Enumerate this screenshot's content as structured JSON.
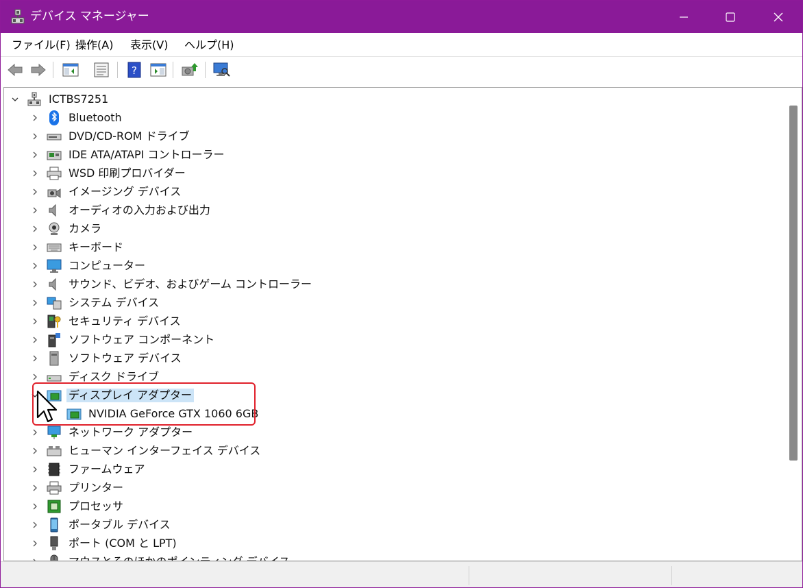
{
  "window": {
    "title": "デバイス マネージャー"
  },
  "menu": [
    "ファイル(F)",
    "操作(A)",
    "表示(V)",
    "ヘルプ(H)"
  ],
  "tree": {
    "root": "ICTBS7251",
    "items": [
      {
        "label": "Bluetooth",
        "icon": "bluetooth-icon"
      },
      {
        "label": "DVD/CD-ROM ドライブ",
        "icon": "dvd-drive-icon"
      },
      {
        "label": "IDE ATA/ATAPI コントローラー",
        "icon": "ide-controller-icon"
      },
      {
        "label": "WSD 印刷プロバイダー",
        "icon": "printer-provider-icon"
      },
      {
        "label": "イメージング デバイス",
        "icon": "camera-imaging-icon"
      },
      {
        "label": "オーディオの入力および出力",
        "icon": "speaker-icon"
      },
      {
        "label": "カメラ",
        "icon": "webcam-icon"
      },
      {
        "label": "キーボード",
        "icon": "keyboard-icon"
      },
      {
        "label": "コンピューター",
        "icon": "monitor-icon"
      },
      {
        "label": "サウンド、ビデオ、およびゲーム コントローラー",
        "icon": "speaker-icon"
      },
      {
        "label": "システム デバイス",
        "icon": "system-device-icon"
      },
      {
        "label": "セキュリティ デバイス",
        "icon": "security-key-icon"
      },
      {
        "label": "ソフトウェア コンポーネント",
        "icon": "software-component-icon"
      },
      {
        "label": "ソフトウェア デバイス",
        "icon": "software-device-icon"
      },
      {
        "label": "ディスク ドライブ",
        "icon": "disk-drive-icon"
      },
      {
        "label": "ディスプレイ アダプター",
        "icon": "display-adapter-icon",
        "expanded": true,
        "selected": true
      },
      {
        "label": "NVIDIA GeForce GTX 1060 6GB",
        "icon": "gpu-icon",
        "child": true
      },
      {
        "label": "ネットワーク アダプター",
        "icon": "network-adapter-icon"
      },
      {
        "label": "ヒューマン インターフェイス デバイス",
        "icon": "hid-icon"
      },
      {
        "label": "ファームウェア",
        "icon": "firmware-chip-icon"
      },
      {
        "label": "プリンター",
        "icon": "printer-icon"
      },
      {
        "label": "プロセッサ",
        "icon": "processor-icon"
      },
      {
        "label": "ポータブル デバイス",
        "icon": "portable-device-icon"
      },
      {
        "label": "ポート (COM と LPT)",
        "icon": "port-icon"
      },
      {
        "label": "マウスとそのほかのポインティング デバイス",
        "icon": "mouse-icon"
      }
    ]
  },
  "colors": {
    "titlebar": "#8a1a98",
    "selection": "#cce4f7",
    "highlight_border": "#e0202a"
  }
}
